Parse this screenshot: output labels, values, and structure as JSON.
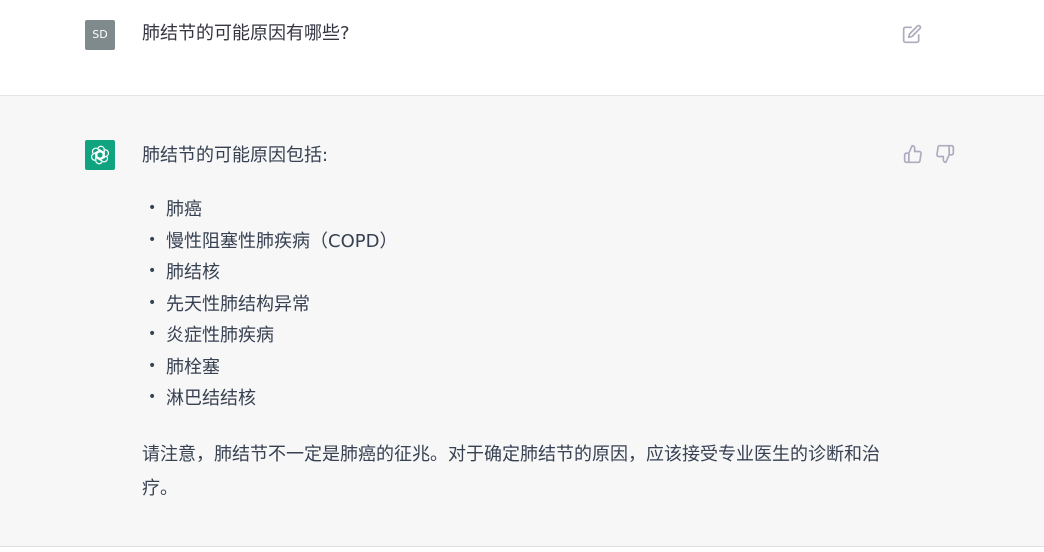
{
  "user_message": {
    "avatar_initials": "SD",
    "text": "肺结节的可能原因有哪些?"
  },
  "assistant_message": {
    "intro": "肺结节的可能原因包括:",
    "items": [
      "肺癌",
      "慢性阻塞性肺疾病（COPD）",
      "肺结核",
      "先天性肺结构异常",
      "炎症性肺疾病",
      "肺栓塞",
      "淋巴结结核"
    ],
    "note": "请注意，肺结节不一定是肺癌的征兆。对于确定肺结节的原因，应该接受专业医生的诊断和治疗。"
  },
  "icons": {
    "edit": "edit-icon",
    "thumb_up": "thumbs-up-icon",
    "thumb_down": "thumbs-down-icon",
    "bot_logo": "openai-logo-icon"
  },
  "colors": {
    "bot_avatar": "#10a37f",
    "user_avatar": "#7f8a8c",
    "assistant_bg": "#f7f7f8"
  }
}
